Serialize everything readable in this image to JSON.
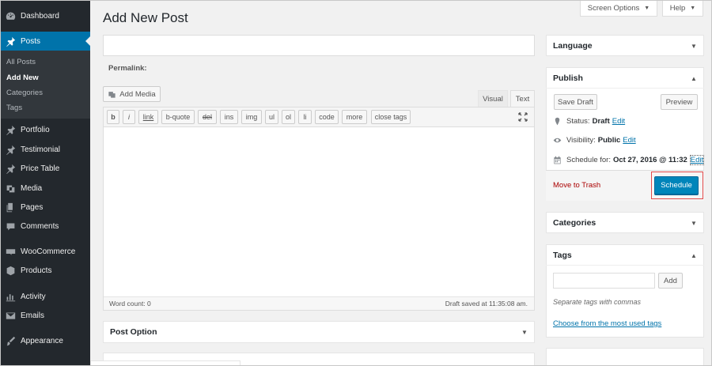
{
  "sidebar": {
    "items": [
      {
        "label": "Dashboard",
        "icon": "dashboard-icon"
      },
      {
        "label": "Posts",
        "icon": "pin-icon",
        "active": true
      },
      {
        "label": "Portfolio",
        "icon": "pin-icon"
      },
      {
        "label": "Testimonial",
        "icon": "pin-icon"
      },
      {
        "label": "Price Table",
        "icon": "pin-icon"
      },
      {
        "label": "Media",
        "icon": "media-icon"
      },
      {
        "label": "Pages",
        "icon": "pages-icon"
      },
      {
        "label": "Comments",
        "icon": "comments-icon"
      },
      {
        "label": "WooCommerce",
        "icon": "woocommerce-icon"
      },
      {
        "label": "Products",
        "icon": "products-icon"
      },
      {
        "label": "Activity",
        "icon": "activity-icon"
      },
      {
        "label": "Emails",
        "icon": "email-icon"
      },
      {
        "label": "Appearance",
        "icon": "appearance-icon"
      }
    ],
    "submenu": [
      "All Posts",
      "Add New",
      "Categories",
      "Tags"
    ]
  },
  "header": {
    "screen_options": "Screen Options",
    "help": "Help",
    "title": "Add New Post"
  },
  "editor": {
    "title_value": "",
    "permalink_label": "Permalink:",
    "add_media": "Add Media",
    "tab_visual": "Visual",
    "tab_text": "Text",
    "quicktags": [
      "b",
      "i",
      "link",
      "b-quote",
      "del",
      "ins",
      "img",
      "ul",
      "ol",
      "li",
      "code",
      "more",
      "close tags"
    ],
    "word_count": "Word count: 0",
    "draft_saved": "Draft saved at 11:35:08 am."
  },
  "post_option": {
    "title": "Post Option"
  },
  "language": {
    "title": "Language"
  },
  "publish": {
    "title": "Publish",
    "save_draft": "Save Draft",
    "preview": "Preview",
    "status_label": "Status:",
    "status_value": "Draft",
    "visibility_label": "Visibility:",
    "visibility_value": "Public",
    "schedule_label": "Schedule for:",
    "schedule_value": "Oct 27, 2016 @ 11:32",
    "edit": "Edit",
    "move_to_trash": "Move to Trash",
    "schedule_button": "Schedule"
  },
  "categories": {
    "title": "Categories"
  },
  "tags": {
    "title": "Tags",
    "input_value": "",
    "add_button": "Add",
    "hint": "Separate tags with commas",
    "choose_link": "Choose from the most used tags"
  },
  "colors": {
    "sidebar": "#23282d",
    "active": "#0073aa",
    "primary_button": "#0085ba",
    "link": "#0073aa",
    "trash": "#aa0000",
    "highlight": "#e24b4b"
  }
}
